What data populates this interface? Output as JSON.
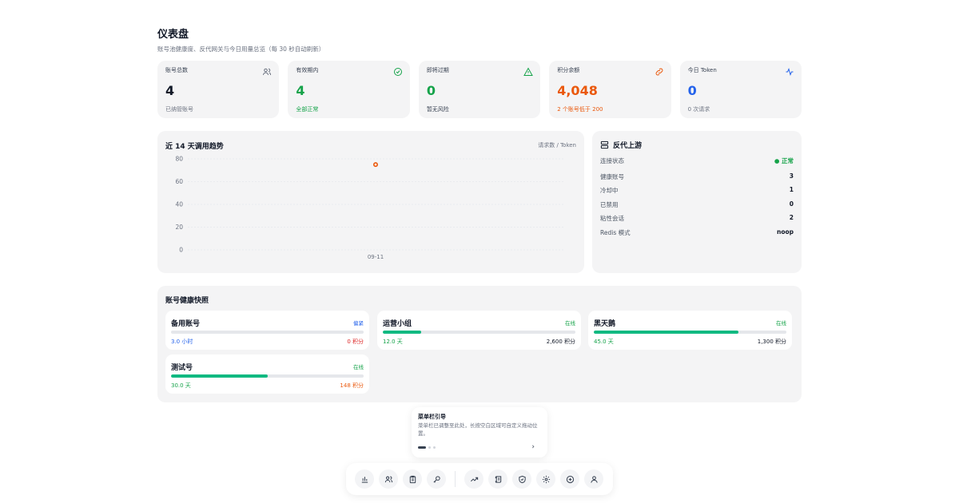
{
  "header": {
    "title": "仪表盘",
    "subtitle": "账号池健康度、反代网关与今日用量总览（每 30 秒自动刷新）"
  },
  "stats": [
    {
      "label": "账号总数",
      "value": "4",
      "sub": "已纳管账号",
      "icon": "users-icon",
      "color": "#111827",
      "sub_color": "#6b7280",
      "icon_color": "#6b7280"
    },
    {
      "label": "有效期内",
      "value": "4",
      "sub": "全部正常",
      "icon": "check-circle-icon",
      "color": "#16a34a",
      "sub_color": "#16a34a",
      "icon_color": "#16a34a"
    },
    {
      "label": "即将过期",
      "value": "0",
      "sub": "暂无风险",
      "icon": "warning-icon",
      "color": "#16a34a",
      "sub_color": "#374151",
      "icon_color": "#16a34a"
    },
    {
      "label": "积分余额",
      "value": "4,048",
      "sub": "2 个账号低于 200",
      "icon": "link-icon",
      "color": "#ea580c",
      "sub_color": "#ea580c",
      "icon_color": "#ea580c"
    },
    {
      "label": "今日 Token",
      "value": "0",
      "sub": "0 次请求",
      "icon": "activity-icon",
      "color": "#2563eb",
      "sub_color": "#6b7280",
      "icon_color": "#2563eb"
    }
  ],
  "trend": {
    "title": "近 14 天调用趋势",
    "right_label": "请求数 / Token"
  },
  "chart_data": {
    "type": "line",
    "x": [
      "09-11"
    ],
    "series": [
      {
        "values": [
          75
        ]
      }
    ],
    "y_ticks": [
      0,
      20,
      40,
      60,
      80
    ],
    "ylim": [
      0,
      80
    ],
    "grid": true,
    "point_color": "#ea580c"
  },
  "upstream": {
    "title": "反代上游",
    "rows": [
      {
        "label": "连接状态",
        "value": "● 正常",
        "status": true
      },
      {
        "label": "健康账号",
        "value": "3"
      },
      {
        "label": "冷却中",
        "value": "1"
      },
      {
        "label": "已禁用",
        "value": "0"
      },
      {
        "label": "粘性会话",
        "value": "2"
      },
      {
        "label": "Redis 模式",
        "value": "noop"
      }
    ]
  },
  "health": {
    "title": "账号健康快照",
    "accounts": [
      {
        "name": "备用账号",
        "badge": "偏紧",
        "badge_color": "#2563eb",
        "progress": 0,
        "left": "3.0 小时",
        "left_color": "#2563eb",
        "right": "0 积分",
        "right_color": "#dc2626"
      },
      {
        "name": "运营小组",
        "badge": "在线",
        "badge_color": "#16a34a",
        "progress": 0.2,
        "left": "12.0 天",
        "left_color": "#16a34a",
        "right": "2,600 积分",
        "right_color": "#111827"
      },
      {
        "name": "黑天鹅",
        "badge": "在线",
        "badge_color": "#16a34a",
        "progress": 0.75,
        "left": "45.0 天",
        "left_color": "#16a34a",
        "right": "1,300 积分",
        "right_color": "#111827"
      },
      {
        "name": "测试号",
        "badge": "在线",
        "badge_color": "#16a34a",
        "progress": 0.5,
        "left": "30.0 天",
        "left_color": "#16a34a",
        "right": "148 积分",
        "right_color": "#ea580c"
      }
    ]
  },
  "guide": {
    "title": "菜单栏引导",
    "text": "菜单栏已调整至此处，长按空白区域可自定义拖动位置。",
    "next": "›"
  },
  "dock": {
    "items": [
      "bar-chart-icon",
      "users-icon",
      "clipboard-icon",
      "key-icon",
      "trending-up-icon",
      "scroll-icon",
      "shield-icon",
      "settings-icon",
      "plus-circle-icon",
      "user-icon"
    ]
  }
}
